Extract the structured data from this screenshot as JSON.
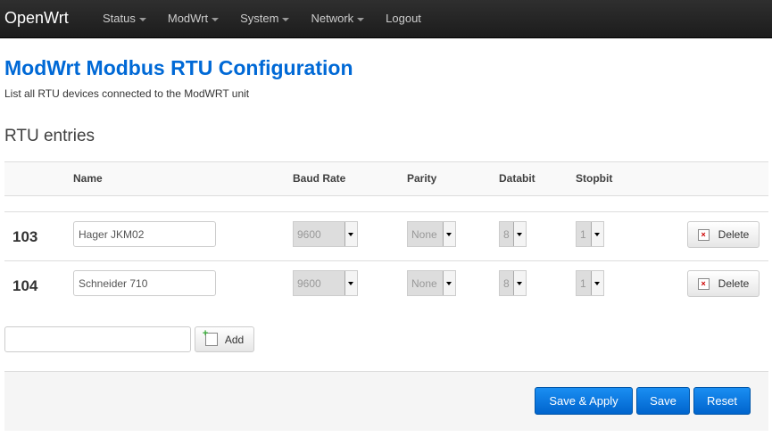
{
  "navbar": {
    "brand": "OpenWrt",
    "menu": [
      {
        "label": "Status",
        "dropdown": true
      },
      {
        "label": "ModWrt",
        "dropdown": true
      },
      {
        "label": "System",
        "dropdown": true
      },
      {
        "label": "Network",
        "dropdown": true
      },
      {
        "label": "Logout",
        "dropdown": false
      }
    ]
  },
  "page": {
    "title": "ModWrt Modbus RTU Configuration",
    "description": "List all RTU devices connected to the ModWRT unit",
    "section_title": "RTU entries"
  },
  "table": {
    "headers": {
      "name": "Name",
      "baud": "Baud Rate",
      "parity": "Parity",
      "databit": "Databit",
      "stopbit": "Stopbit"
    },
    "rows": [
      {
        "id": "103",
        "name": "Hager JKM02",
        "baud": "9600",
        "parity": "None",
        "databit": "8",
        "stopbit": "1",
        "delete_label": "Delete"
      },
      {
        "id": "104",
        "name": "Schneider 710",
        "baud": "9600",
        "parity": "None",
        "databit": "8",
        "stopbit": "1",
        "delete_label": "Delete"
      }
    ]
  },
  "add": {
    "input_value": "",
    "button_label": "Add"
  },
  "actions": {
    "save_apply": "Save & Apply",
    "save": "Save",
    "reset": "Reset"
  },
  "colors": {
    "title": "#0069d6",
    "primary_button": "#0064cd",
    "navbar": "#222222"
  }
}
